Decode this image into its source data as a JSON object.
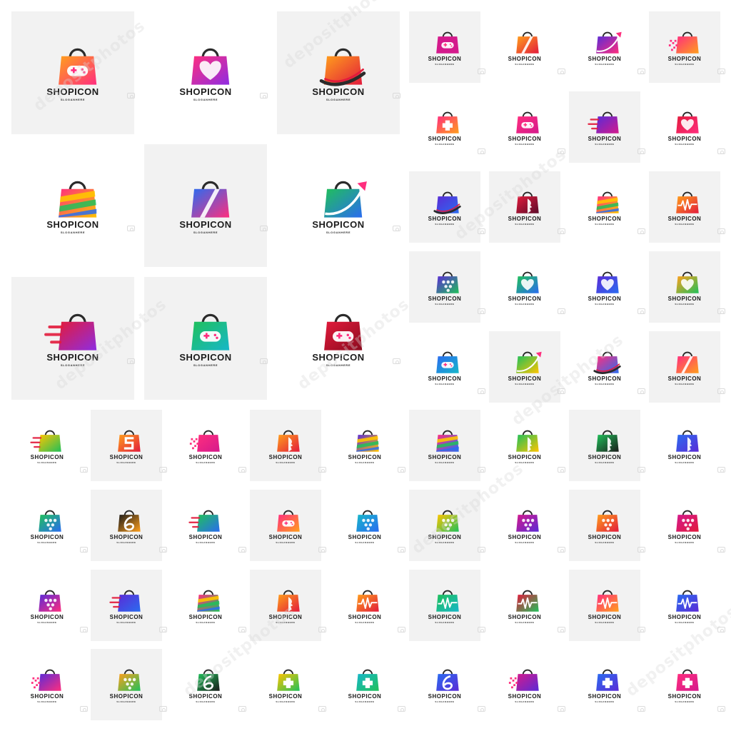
{
  "sheet": {
    "logo_text": "SHOPICON",
    "slogan": "SLOGANHERE",
    "watermark": "depositphotos"
  },
  "palette": {
    "purple": "#5b2bd6",
    "magenta": "#d41a8c",
    "pink": "#ff2e7e",
    "orange": "#ff8a00",
    "yellow": "#ffc400",
    "green": "#20c05a",
    "teal": "#17b7c9",
    "blue": "#2a6cf0",
    "red": "#e21b3c"
  },
  "logos": [
    {
      "icon": "gamepad-bag-icon",
      "g": [
        "#ff9f1c",
        "#ff2e7e"
      ],
      "tone": "gray"
    },
    {
      "icon": "heart-bag-icon",
      "g": [
        "#ff2e7e",
        "#8e2de2"
      ],
      "tone": "white"
    },
    {
      "icon": "shoe-bag-icon",
      "g": [
        "#ff9f1c",
        "#e21b3c"
      ],
      "tone": "gray"
    },
    {
      "icon": "rainbow-bag-icon",
      "g": [
        "#ff2e7e",
        "#ffc400"
      ],
      "tone": "white"
    },
    {
      "icon": "slash-bag-icon",
      "g": [
        "#2a6cf0",
        "#ff2e7e"
      ],
      "tone": "gray"
    },
    {
      "icon": "arrow-bag-icon",
      "g": [
        "#20c05a",
        "#2a6cf0"
      ],
      "tone": "white"
    },
    {
      "icon": "speed-bag-icon",
      "g": [
        "#e21b3c",
        "#8e2de2"
      ],
      "tone": "gray"
    },
    {
      "icon": "gamepad-bag-icon",
      "g": [
        "#20c05a",
        "#17b7c9"
      ],
      "tone": "gray"
    },
    {
      "icon": "gamepad-bag-icon",
      "g": [
        "#e21b3c",
        "#8b0a1e"
      ],
      "tone": "white"
    },
    {
      "icon": "gamepad-bag-icon",
      "g": [
        "#d41a8c",
        "#d41a8c"
      ],
      "tone": "gray"
    },
    {
      "icon": "slash-bag-icon",
      "g": [
        "#ff9f1c",
        "#e21b3c"
      ],
      "tone": "white"
    },
    {
      "icon": "arrow-bag-icon",
      "g": [
        "#5b2bd6",
        "#ff2e7e"
      ],
      "tone": "white"
    },
    {
      "icon": "pixel-bag-icon",
      "g": [
        "#ff2e7e",
        "#ff9f1c"
      ],
      "tone": "gray"
    },
    {
      "icon": "plus-bag-icon",
      "g": [
        "#ff2e7e",
        "#ff9f1c"
      ],
      "tone": "white"
    },
    {
      "icon": "gamepad-bag-icon",
      "g": [
        "#ff2e7e",
        "#d41a8c"
      ],
      "tone": "white"
    },
    {
      "icon": "speed-bag-icon",
      "g": [
        "#5b2bd6",
        "#d41a8c"
      ],
      "tone": "gray"
    },
    {
      "icon": "heart-bag-icon",
      "g": [
        "#e21b3c",
        "#ff2e7e"
      ],
      "tone": "white"
    },
    {
      "icon": "shoe-bag-icon",
      "g": [
        "#5b2bd6",
        "#2a6cf0"
      ],
      "tone": "gray"
    },
    {
      "icon": "face-bag-icon",
      "g": [
        "#e21b3c",
        "#5b0b2a"
      ],
      "tone": "gray"
    },
    {
      "icon": "rainbow-bag-icon",
      "g": [
        "#ff2e7e",
        "#ffc400"
      ],
      "tone": "white"
    },
    {
      "icon": "wave-bag-icon",
      "g": [
        "#ff9f1c",
        "#e21b3c"
      ],
      "tone": "gray"
    },
    {
      "icon": "dots-bag-icon",
      "g": [
        "#5b2bd6",
        "#20c05a"
      ],
      "tone": "gray"
    },
    {
      "icon": "heart-bag-icon",
      "g": [
        "#20c05a",
        "#2a6cf0"
      ],
      "tone": "white"
    },
    {
      "icon": "heart-bag-icon",
      "g": [
        "#5b2bd6",
        "#2a6cf0"
      ],
      "tone": "white"
    },
    {
      "icon": "heart-bag-icon",
      "g": [
        "#ff9f1c",
        "#20c05a"
      ],
      "tone": "gray"
    },
    {
      "icon": "gamepad-bag-icon",
      "g": [
        "#2a6cf0",
        "#17b7c9"
      ],
      "tone": "white"
    },
    {
      "icon": "arrow-bag-icon",
      "g": [
        "#20c05a",
        "#ffc400"
      ],
      "tone": "gray"
    },
    {
      "icon": "shoe-bag-icon",
      "g": [
        "#ff2e7e",
        "#2a6cf0"
      ],
      "tone": "white"
    },
    {
      "icon": "slash-bag-icon",
      "g": [
        "#ff2e7e",
        "#ff9f1c"
      ],
      "tone": "gray"
    },
    {
      "icon": "speed-bag-icon",
      "g": [
        "#ffc400",
        "#20c05a"
      ],
      "tone": "white"
    },
    {
      "icon": "letter-s-bag-icon",
      "g": [
        "#ff9f1c",
        "#e21b3c"
      ],
      "tone": "gray"
    },
    {
      "icon": "pixel-bag-icon",
      "g": [
        "#ff2e7e",
        "#d41a8c"
      ],
      "tone": "white"
    },
    {
      "icon": "face-bag-icon",
      "g": [
        "#ff9f1c",
        "#e21b3c"
      ],
      "tone": "gray"
    },
    {
      "icon": "rainbow-bag-icon",
      "g": [
        "#5b2bd6",
        "#ffc400"
      ],
      "tone": "white"
    },
    {
      "icon": "rainbow-bag-icon",
      "g": [
        "#ff2e7e",
        "#2a6cf0"
      ],
      "tone": "gray"
    },
    {
      "icon": "face-bag-icon",
      "g": [
        "#20c05a",
        "#ffc400"
      ],
      "tone": "white"
    },
    {
      "icon": "face-bag-icon",
      "g": [
        "#20c05a",
        "#1b1b1b"
      ],
      "tone": "gray"
    },
    {
      "icon": "face-bag-icon",
      "g": [
        "#2a6cf0",
        "#5b2bd6"
      ],
      "tone": "white"
    },
    {
      "icon": "dots-bag-icon",
      "g": [
        "#20c05a",
        "#2a6cf0"
      ],
      "tone": "white"
    },
    {
      "icon": "number-6-bag-icon",
      "g": [
        "#1b1b1b",
        "#ff9f1c"
      ],
      "tone": "gray"
    },
    {
      "icon": "speed-bag-icon",
      "g": [
        "#20c05a",
        "#2a6cf0"
      ],
      "tone": "white"
    },
    {
      "icon": "gamepad-bag-icon",
      "g": [
        "#ff2e7e",
        "#ff9f1c"
      ],
      "tone": "gray"
    },
    {
      "icon": "dots-bag-icon",
      "g": [
        "#17b7c9",
        "#2a6cf0"
      ],
      "tone": "white"
    },
    {
      "icon": "dots-bag-icon",
      "g": [
        "#ffc400",
        "#20c05a"
      ],
      "tone": "gray"
    },
    {
      "icon": "dots-bag-icon",
      "g": [
        "#d41a8c",
        "#5b2bd6"
      ],
      "tone": "white"
    },
    {
      "icon": "dots-bag-icon",
      "g": [
        "#ff9f1c",
        "#e21b3c"
      ],
      "tone": "gray"
    },
    {
      "icon": "dots-bag-icon",
      "g": [
        "#d41a8c",
        "#e21b3c"
      ],
      "tone": "white"
    },
    {
      "icon": "dots-bag-icon",
      "g": [
        "#5b2bd6",
        "#ff2e7e"
      ],
      "tone": "white"
    },
    {
      "icon": "speed-bag-icon",
      "g": [
        "#5b2bd6",
        "#2a6cf0"
      ],
      "tone": "gray"
    },
    {
      "icon": "rainbow-bag-icon",
      "g": [
        "#ff2e7e",
        "#20c05a"
      ],
      "tone": "white"
    },
    {
      "icon": "face-bag-icon",
      "g": [
        "#ff9f1c",
        "#e21b3c"
      ],
      "tone": "gray"
    },
    {
      "icon": "wave-bag-icon",
      "g": [
        "#ff9f1c",
        "#e21b3c"
      ],
      "tone": "white"
    },
    {
      "icon": "wave-bag-icon",
      "g": [
        "#20c05a",
        "#17b7c9"
      ],
      "tone": "gray"
    },
    {
      "icon": "wave-bag-icon",
      "g": [
        "#e21b3c",
        "#20c05a"
      ],
      "tone": "white"
    },
    {
      "icon": "wave-bag-icon",
      "g": [
        "#ff2e7e",
        "#ff9f1c"
      ],
      "tone": "gray"
    },
    {
      "icon": "wave-bag-icon",
      "g": [
        "#2a6cf0",
        "#5b2bd6"
      ],
      "tone": "white"
    },
    {
      "icon": "pixel-bag-icon",
      "g": [
        "#5b2bd6",
        "#ff2e7e"
      ],
      "tone": "white"
    },
    {
      "icon": "dots-bag-icon",
      "g": [
        "#ff9f1c",
        "#20c05a"
      ],
      "tone": "gray"
    },
    {
      "icon": "number-6-bag-icon",
      "g": [
        "#20c05a",
        "#1b1b1b"
      ],
      "tone": "white"
    },
    {
      "icon": "plus-bag-icon",
      "g": [
        "#ffc400",
        "#20c05a"
      ],
      "tone": "white"
    },
    {
      "icon": "plus-bag-icon",
      "g": [
        "#17b7c9",
        "#20c05a"
      ],
      "tone": "white"
    },
    {
      "icon": "number-6-bag-icon",
      "g": [
        "#2a6cf0",
        "#5b2bd6"
      ],
      "tone": "white"
    },
    {
      "icon": "pixel-bag-icon",
      "g": [
        "#d41a8c",
        "#5b2bd6"
      ],
      "tone": "white"
    },
    {
      "icon": "plus-bag-icon",
      "g": [
        "#2a6cf0",
        "#5b2bd6"
      ],
      "tone": "white"
    },
    {
      "icon": "plus-bag-icon",
      "g": [
        "#ff2e7e",
        "#d41a8c"
      ],
      "tone": "white"
    }
  ]
}
